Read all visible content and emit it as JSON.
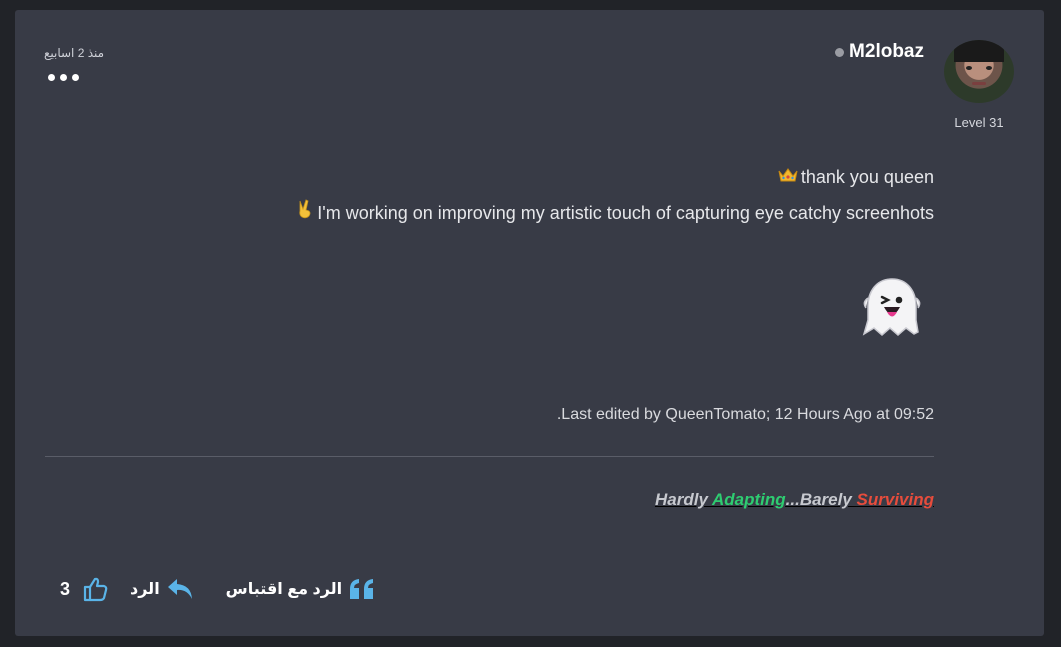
{
  "post": {
    "date": "منذ 2 اسابيع",
    "author": {
      "name": "M2lobaz",
      "level": "Level 31",
      "status_color": "#9a9ca3"
    },
    "body": {
      "line1": "thank you queen",
      "line1_icon": "crown-emoji",
      "line2": "I'm working on improving my artistic touch of capturing eye catchy screenhots",
      "line2_icon": "victory-hand-emoji",
      "image_icon": "winking-ghost-emoji"
    },
    "edited_text": ".Last edited by QueenTomato; 12 Hours Ago at 09:52",
    "signature": {
      "part1": "Hardly ",
      "part2": "Adapting",
      "part3": "...Barely ",
      "part4": "Surviving",
      "colors": {
        "adapting": "#2ecc71",
        "surviving": "#e74c3c"
      }
    },
    "actions": {
      "quote_reply_label": "الرد مع اقتباس",
      "reply_label": "الرد",
      "like_count": "3",
      "accent": "#5ab4e8"
    }
  }
}
